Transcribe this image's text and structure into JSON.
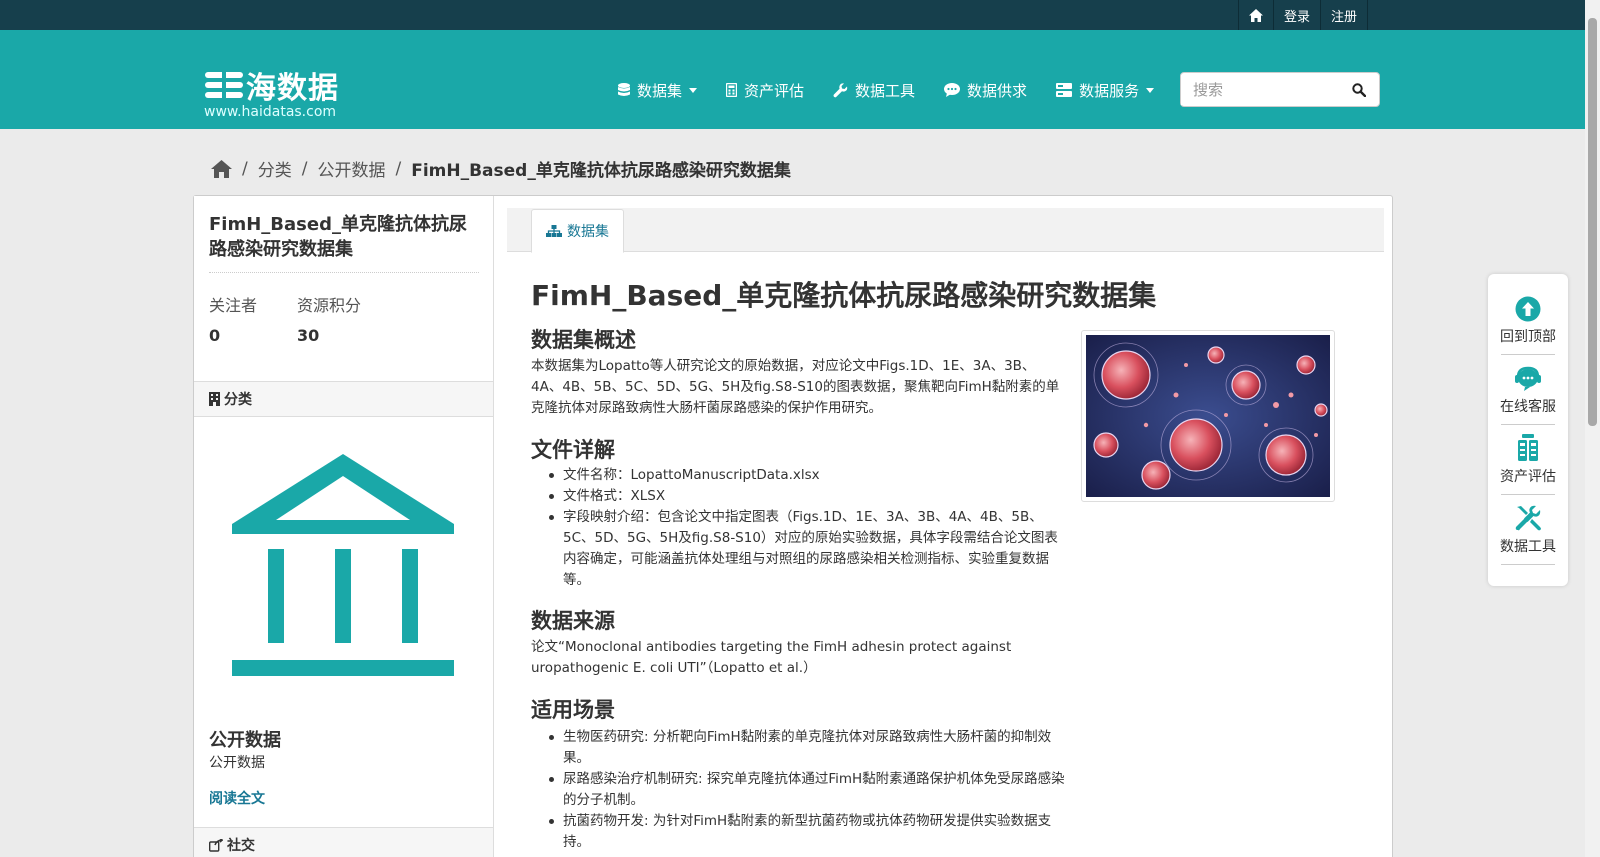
{
  "topbar": {
    "login": "登录",
    "register": "注册"
  },
  "site": {
    "logo_text": "海数据",
    "url": "www.haidatas.com"
  },
  "nav": {
    "items": [
      {
        "label": "数据集",
        "icon": "database-icon",
        "dropdown": true
      },
      {
        "label": "资产评估",
        "icon": "calculator-icon",
        "dropdown": false
      },
      {
        "label": "数据工具",
        "icon": "wrench-icon",
        "dropdown": false
      },
      {
        "label": "数据供求",
        "icon": "comment-icon",
        "dropdown": false
      },
      {
        "label": "数据服务",
        "icon": "server-icon",
        "dropdown": true
      }
    ]
  },
  "search": {
    "placeholder": "搜索"
  },
  "breadcrumb": {
    "items": [
      "分类",
      "公开数据"
    ],
    "active": "FimH_Based_单克隆抗体抗尿路感染研究数据集"
  },
  "sidebar": {
    "title": "FimH_Based_单克隆抗体抗尿路感染研究数据集",
    "followers_label": "关注者",
    "followers_value": "0",
    "points_label": "资源积分",
    "points_value": "30",
    "category_heading": "分类",
    "org_name": "公开数据",
    "org_desc": "公开数据",
    "read_more": "阅读全文",
    "social_heading": "社交"
  },
  "tabs": {
    "dataset": "数据集"
  },
  "article": {
    "title": "FimH_Based_单克隆抗体抗尿路感染研究数据集",
    "overview_heading": "数据集概述",
    "overview_text": "本数据集为Lopatto等人研究论文的原始数据，对应论文中Figs.1D、1E、3A、3B、4A、4B、5B、5C、5D、5G、5H及fig.S8-S10的图表数据，聚焦靶向FimH黏附素的单克隆抗体对尿路致病性大肠杆菌尿路感染的保护作用研究。",
    "files_heading": "文件详解",
    "files": [
      "文件名称：LopattoManuscriptData.xlsx",
      "文件格式：XLSX",
      "字段映射介绍：包含论文中指定图表（Figs.1D、1E、3A、3B、4A、4B、5B、5C、5D、5G、5H及fig.S8-S10）对应的原始实验数据，具体字段需结合论文图表内容确定，可能涵盖抗体处理组与对照组的尿路感染相关检测指标、实验重复数据等。"
    ],
    "source_heading": "数据来源",
    "source_text": "论文“Monoclonal antibodies targeting the FimH adhesin protect against uropathogenic E. coli UTI”（Lopatto et al.）",
    "scenarios_heading": "适用场景",
    "scenarios": [
      "生物医药研究: 分析靶向FimH黏附素的单克隆抗体对尿路致病性大肠杆菌的抑制效果。",
      "尿路感染治疗机制研究: 探究单克隆抗体通过FimH黏附素通路保护机体免受尿路感染的分子机制。",
      "抗菌药物开发: 为针对FimH黏附素的新型抗菌药物或抗体药物研发提供实验数据支持。"
    ]
  },
  "float_tools": [
    {
      "label": "回到顶部",
      "icon": "arrow-up-circle-icon"
    },
    {
      "label": "在线客服",
      "icon": "customer-service-icon"
    },
    {
      "label": "资产评估",
      "icon": "calculator-icon"
    },
    {
      "label": "数据工具",
      "icon": "tools-icon"
    }
  ],
  "colors": {
    "topbar": "#163f4c",
    "masthead": "#1aa8a8",
    "accent": "#187794",
    "org_icon": "#1aa8a8"
  }
}
